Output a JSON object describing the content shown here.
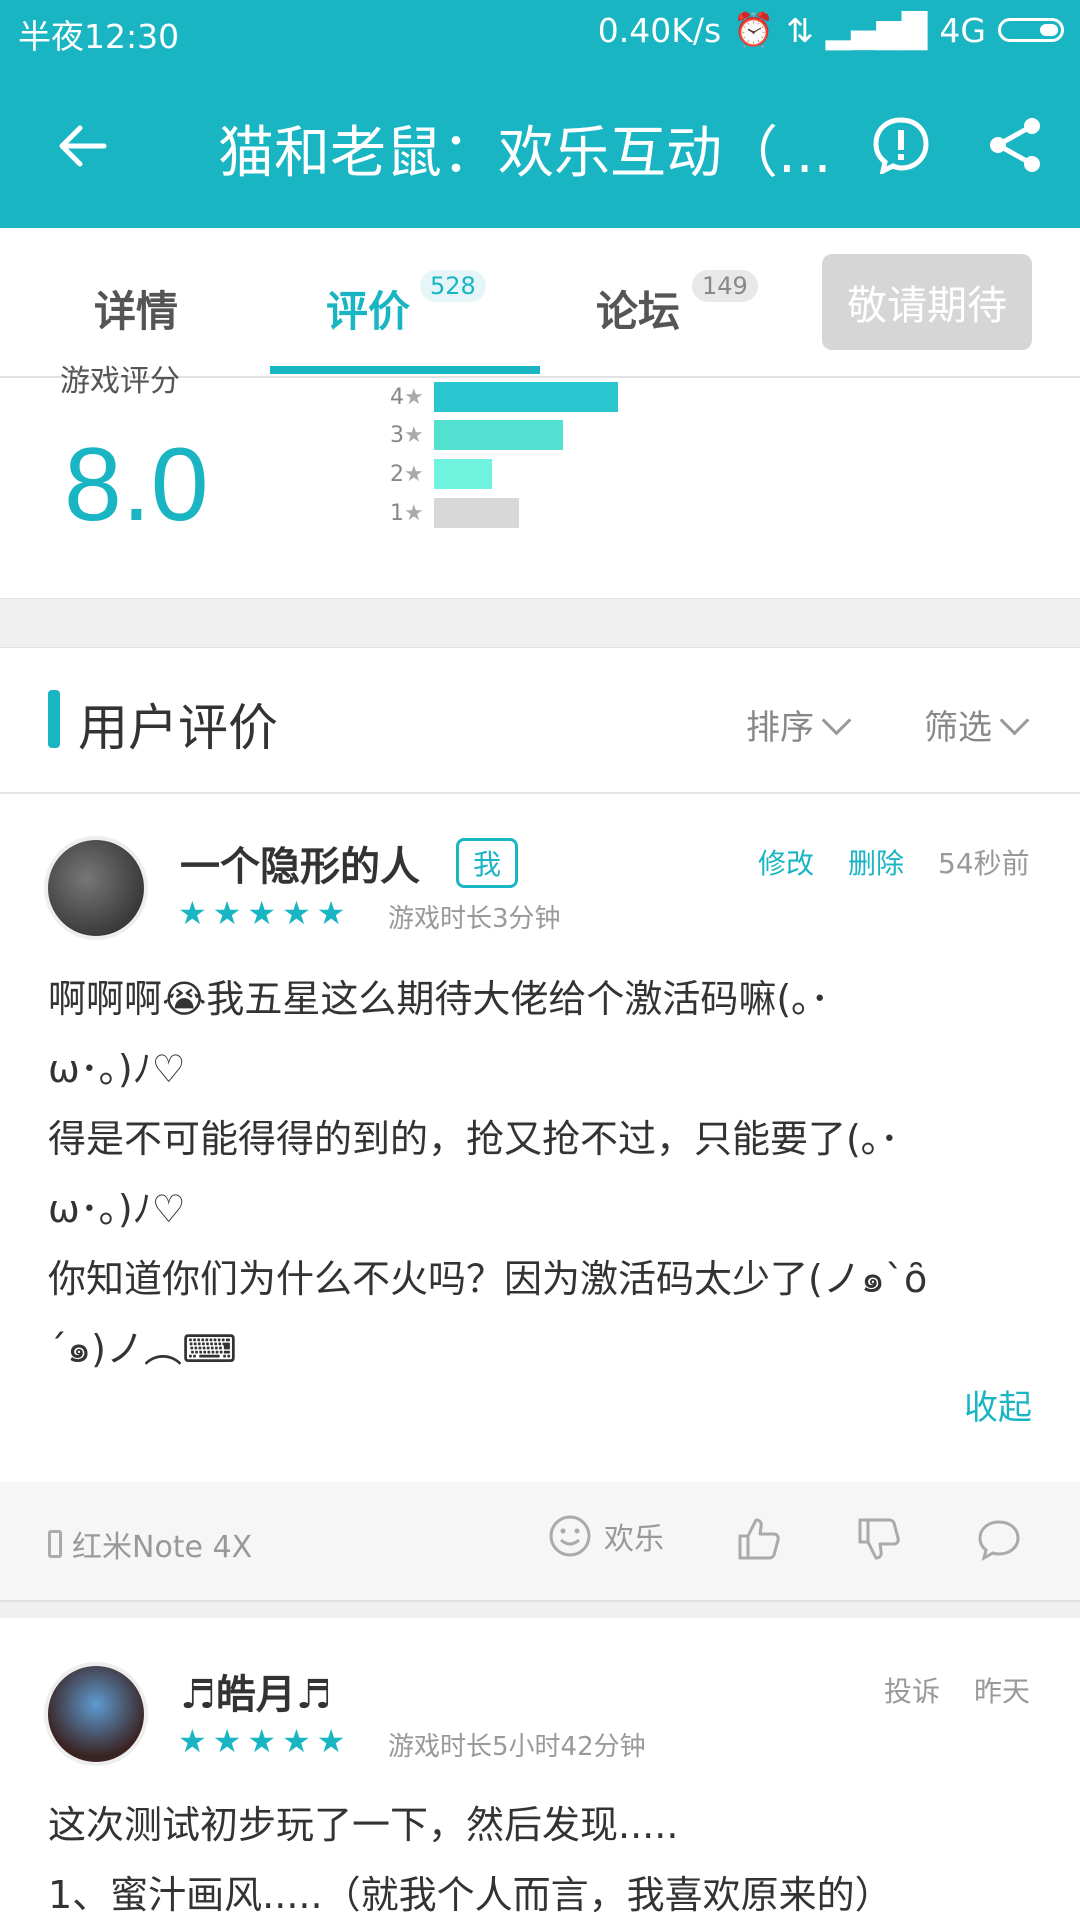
{
  "status_bar": {
    "time": "半夜12:30",
    "speed": "0.40K/s",
    "network": "4G"
  },
  "app_bar": {
    "title": "猫和老鼠：欢乐互动（..."
  },
  "tabs": [
    {
      "label": "详情"
    },
    {
      "label": "评价",
      "count": "528"
    },
    {
      "label": "论坛",
      "count": "149"
    }
  ],
  "expect_button": "敬请期待",
  "rating": {
    "label": "游戏评分",
    "score": "8.0",
    "bars": [
      {
        "stars": "4",
        "fraction": 0.54,
        "color": "#2ac6cf"
      },
      {
        "stars": "3",
        "fraction": 0.38,
        "color": "#52e0d0"
      },
      {
        "stars": "2",
        "fraction": 0.17,
        "color": "#6ff3df"
      },
      {
        "stars": "1",
        "fraction": 0.25,
        "color": "#d8d8d8"
      }
    ]
  },
  "section": {
    "title": "用户评价",
    "sort": "排序",
    "filter": "筛选"
  },
  "review1": {
    "user": "一个隐形的人",
    "me_badge": "我",
    "edit": "修改",
    "delete": "删除",
    "time": "54秒前",
    "stars": "★★★★★",
    "playtime": "游戏时长3分钟",
    "text": "啊啊啊😭我五星这么期待大佬给个激活码嘛(｡･\nω･｡)ﾉ♡\n得是不可能得得的到的，抢又抢不过，只能要了(｡･\nω･｡)ﾉ♡\n你知道你们为什么不火吗？因为激活码太少了(ノ๑`ȏ\n´๑)ノ︵⌨",
    "collapse": "收起",
    "device": "红米Note 4X",
    "mood": "欢乐"
  },
  "review2": {
    "user": "♬皓月♬",
    "report": "投诉",
    "time": "昨天",
    "stars": "★★★★★",
    "playtime": "游戏时长5小时42分钟",
    "text": "这次测试初步玩了一下，然后发现.....\n1、蜜汁画风.....（就我个人而言，我喜欢原来的）"
  }
}
